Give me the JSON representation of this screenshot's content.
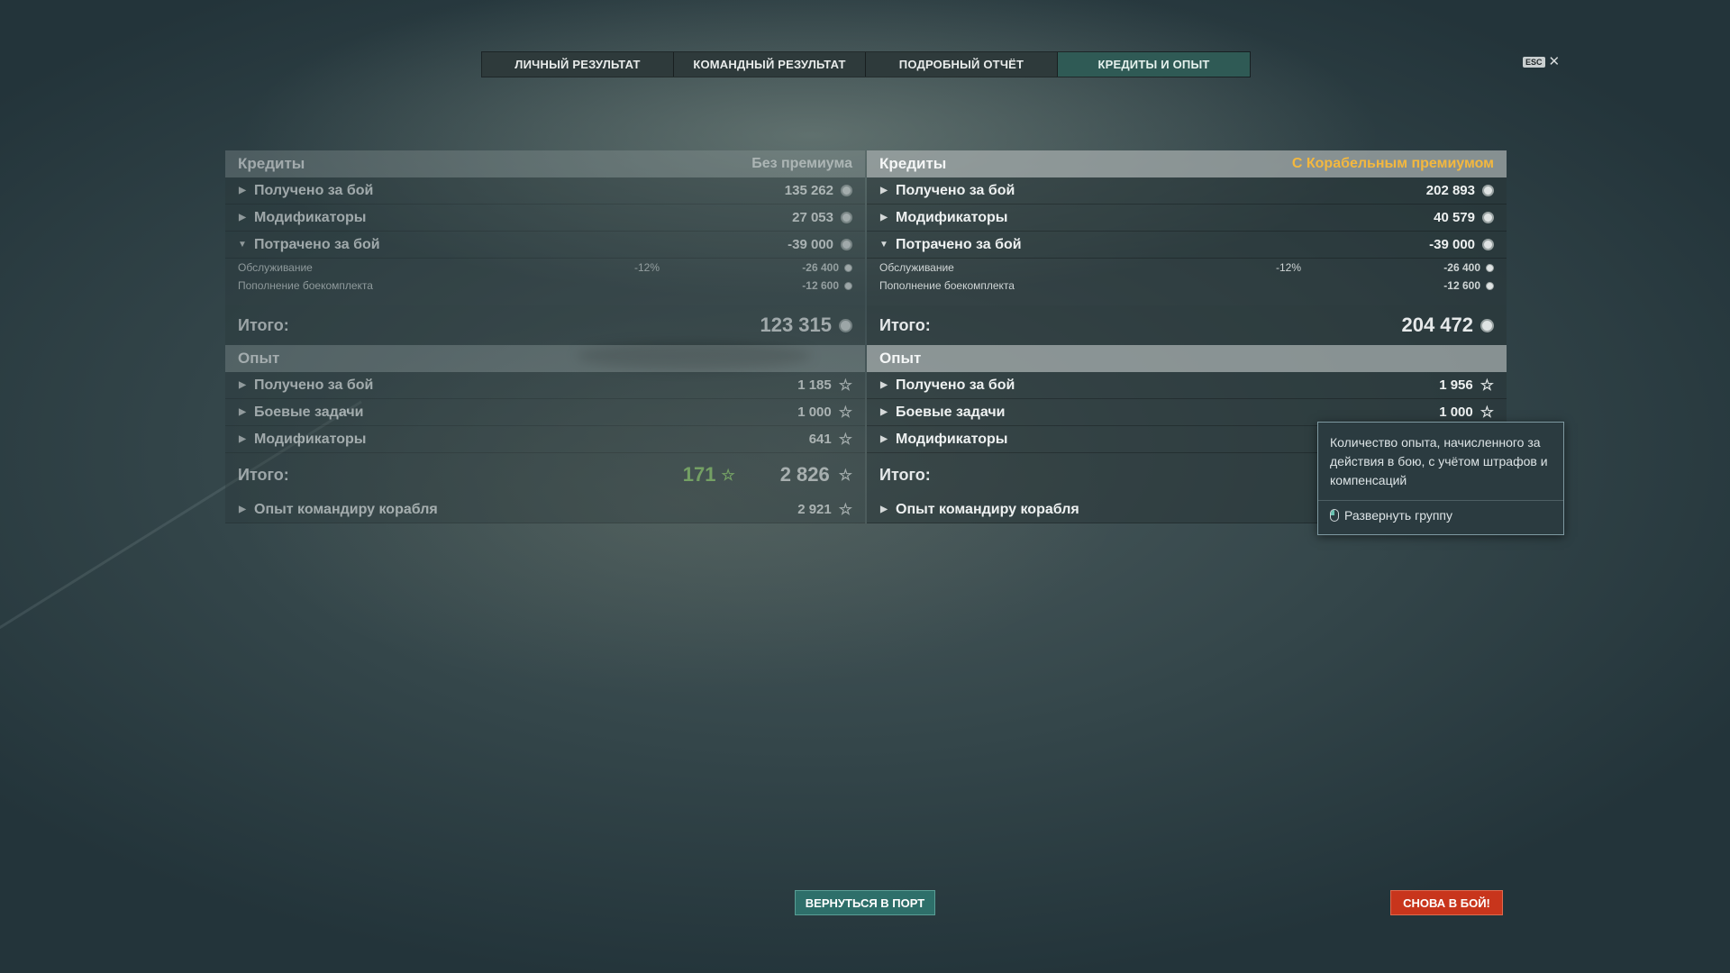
{
  "tabs": [
    {
      "label": "ЛИЧНЫЙ РЕЗУЛЬТАТ",
      "active": false
    },
    {
      "label": "КОМАНДНЫЙ РЕЗУЛЬТАТ",
      "active": false
    },
    {
      "label": "ПОДРОБНЫЙ ОТЧЁТ",
      "active": false
    },
    {
      "label": "КРЕДИТЫ И ОПЫТ",
      "active": true
    }
  ],
  "esc": {
    "key": "ESC",
    "close_symbol": "✕"
  },
  "left": {
    "credits_title": "Кредиты",
    "credits_sub": "Без премиума",
    "earned_label": "Получено за бой",
    "earned_value": "135 262",
    "mods_label": "Модификаторы",
    "mods_value": "27 053",
    "spent_label": "Потрачено за бой",
    "spent_value": "-39 000",
    "service_label": "Обслуживание",
    "service_pct": "-12%",
    "service_value": "-26 400",
    "ammo_label": "Пополнение боекомплекта",
    "ammo_value": "-12 600",
    "total_label": "Итого:",
    "total_value": "123 315",
    "xp_title": "Опыт",
    "xp_earned_label": "Получено за бой",
    "xp_earned_value": "1 185",
    "xp_tasks_label": "Боевые задачи",
    "xp_tasks_value": "1 000",
    "xp_mods_label": "Модификаторы",
    "xp_mods_value": "641",
    "xp_total_label": "Итого:",
    "xp_total_free": "171",
    "xp_total_value": "2 826",
    "cmdr_label": "Опыт командиру корабля",
    "cmdr_value": "2 921"
  },
  "right": {
    "credits_title": "Кредиты",
    "credits_sub": "С Корабельным премиумом",
    "earned_label": "Получено за бой",
    "earned_value": "202 893",
    "mods_label": "Модификаторы",
    "mods_value": "40 579",
    "spent_label": "Потрачено за бой",
    "spent_value": "-39 000",
    "service_label": "Обслуживание",
    "service_pct": "-12%",
    "service_value": "-26 400",
    "ammo_label": "Пополнение боекомплекта",
    "ammo_value": "-12 600",
    "total_label": "Итого:",
    "total_value": "204 472",
    "xp_title": "Опыт",
    "xp_earned_label": "Получено за бой",
    "xp_earned_value": "1 956",
    "xp_tasks_label": "Боевые задачи",
    "xp_tasks_value": "1 000",
    "xp_mods_label": "Модификаторы",
    "xp_total_label": "Итого:",
    "cmdr_label": "Опыт командиру корабля"
  },
  "tooltip": {
    "text": "Количество опыта, начисленного за действия в бою, с учётом штрафов и компенсаций",
    "hint": "Развернуть группу"
  },
  "buttons": {
    "port": "ВЕРНУТЬСЯ В ПОРТ",
    "battle": "СНОВА В БОЙ!"
  },
  "colors": {
    "premium_accent": "#f4b83e",
    "free_xp": "#8fd06a",
    "battle_button": "#c8351c",
    "port_button": "#2e6f6a"
  },
  "icons": [
    "credits-coin-icon",
    "xp-star-icon",
    "expand-arrow-icon",
    "collapse-arrow-icon",
    "mouse-icon",
    "close-icon"
  ]
}
